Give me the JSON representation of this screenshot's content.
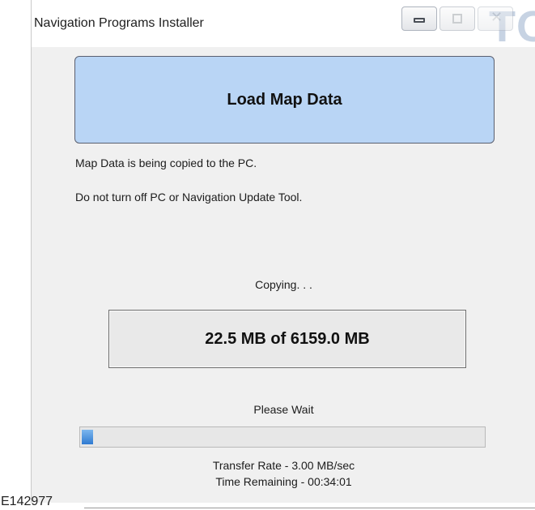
{
  "window": {
    "title": "Navigation Programs Installer",
    "background_text": "TO",
    "controls": [
      "minimize",
      "maximize",
      "close"
    ]
  },
  "header": {
    "title": "Load Map Data",
    "accent_color": "#b9d5f5"
  },
  "messages": {
    "line1": "Map Data is being copied to the PC.",
    "line2": "Do not turn off PC or Navigation Update Tool."
  },
  "status": {
    "copying": "Copying. . .",
    "size": "22.5 MB of 6159.0 MB",
    "please_wait": "Please Wait",
    "progress_fraction": 0.0037,
    "progress_color": "#2f7ad1",
    "transfer_rate": "Transfer Rate - 3.00 MB/sec",
    "time_remaining": "Time Remaining - 00:34:01"
  },
  "figure_ref": "E142977"
}
